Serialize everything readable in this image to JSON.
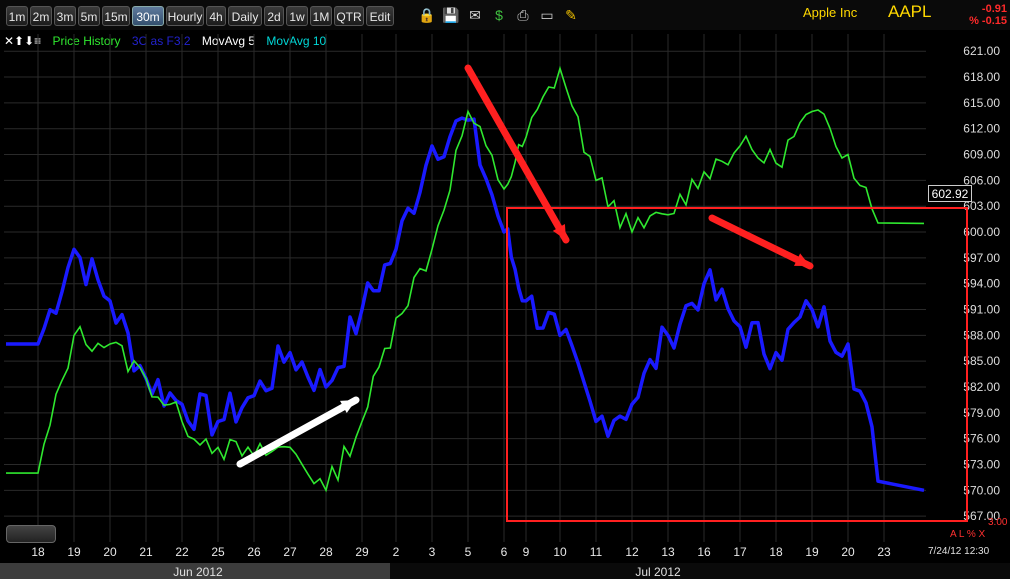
{
  "toolbar": {
    "intervals": [
      {
        "label": "1m",
        "active": false
      },
      {
        "label": "2m",
        "active": false
      },
      {
        "label": "3m",
        "active": false
      },
      {
        "label": "5m",
        "active": false
      },
      {
        "label": "15m",
        "active": false
      },
      {
        "label": "30m",
        "active": true
      },
      {
        "label": "Hourly",
        "active": false
      },
      {
        "label": "4h",
        "active": false
      },
      {
        "label": "Daily",
        "active": false
      },
      {
        "label": "2d",
        "active": false
      },
      {
        "label": "1w",
        "active": false
      },
      {
        "label": "1M",
        "active": false
      },
      {
        "label": "QTR",
        "active": false
      },
      {
        "label": "Edit",
        "active": false
      }
    ],
    "icons": [
      "lock-icon",
      "save-icon",
      "mail-icon",
      "dollar-icon",
      "print-icon",
      "card-icon",
      "pencil-icon"
    ]
  },
  "header": {
    "company": "Apple Inc",
    "ticker": "AAPL",
    "change": "-0.91",
    "change_pct": "% -0.15"
  },
  "legend": {
    "icons": "✕⬆⬇≡",
    "price": "Price History",
    "indicator": "3C as F3.2",
    "ma5": "MovAvg 5",
    "ma10": "MovAvg 10"
  },
  "colors": {
    "price": "#2fe82f",
    "indicator": "#1a1aff",
    "ma10": "#00d8d8",
    "annotation_red": "#ff2020",
    "annotation_white": "#ffffff",
    "grid": "#2a2a2a"
  },
  "last_price": "602.92",
  "timestamp": "7/24/12 12:30",
  "scale_min_label": "3.00",
  "scale_controls": "A L % X",
  "chart_data": {
    "type": "line",
    "y_ticks": [
      "621.00",
      "618.00",
      "615.00",
      "612.00",
      "609.00",
      "606.00",
      "603.00",
      "600.00",
      "597.00",
      "594.00",
      "591.00",
      "588.00",
      "585.00",
      "582.00",
      "579.00",
      "576.00",
      "573.00",
      "570.00",
      "567.00"
    ],
    "y_tick_values": [
      621,
      618,
      615,
      612,
      609,
      606,
      603,
      600,
      597,
      594,
      591,
      588,
      585,
      582,
      579,
      576,
      573,
      570,
      567
    ],
    "x_ticks": [
      "18",
      "19",
      "20",
      "21",
      "22",
      "25",
      "26",
      "27",
      "28",
      "29",
      "2",
      "3",
      "5",
      "6",
      "9",
      "10",
      "11",
      "12",
      "13",
      "16",
      "17",
      "18",
      "19",
      "20",
      "23"
    ],
    "months": [
      "Jun 2012",
      "Jul 2012"
    ],
    "ylim": [
      564,
      623
    ],
    "series": [
      {
        "name": "Price History",
        "x": [
          "18",
          "19",
          "20",
          "21",
          "22",
          "25",
          "26",
          "27",
          "28",
          "29",
          "2",
          "3",
          "5",
          "6",
          "9",
          "10",
          "11",
          "12",
          "13",
          "16",
          "17",
          "18",
          "19",
          "20",
          "23"
        ],
        "values": [
          572,
          588,
          587,
          583,
          578,
          575,
          574,
          575,
          570,
          578,
          590,
          598,
          614,
          605,
          611,
          619,
          606,
          600,
          602,
          607,
          610,
          608,
          614,
          609,
          601
        ]
      },
      {
        "name": "3C as F3.2",
        "x": [
          "18",
          "19",
          "20",
          "21",
          "22",
          "25",
          "26",
          "27",
          "28",
          "29",
          "2",
          "3",
          "5",
          "6",
          "9",
          "10",
          "11",
          "12",
          "13",
          "16",
          "17",
          "18",
          "19",
          "20",
          "23"
        ],
        "values": [
          587,
          598,
          592,
          583,
          580,
          578,
          581,
          586,
          582,
          591,
          598,
          610,
          613,
          600,
          592,
          588,
          578,
          580,
          588,
          594,
          589,
          586,
          591,
          587,
          570
        ]
      }
    ]
  }
}
